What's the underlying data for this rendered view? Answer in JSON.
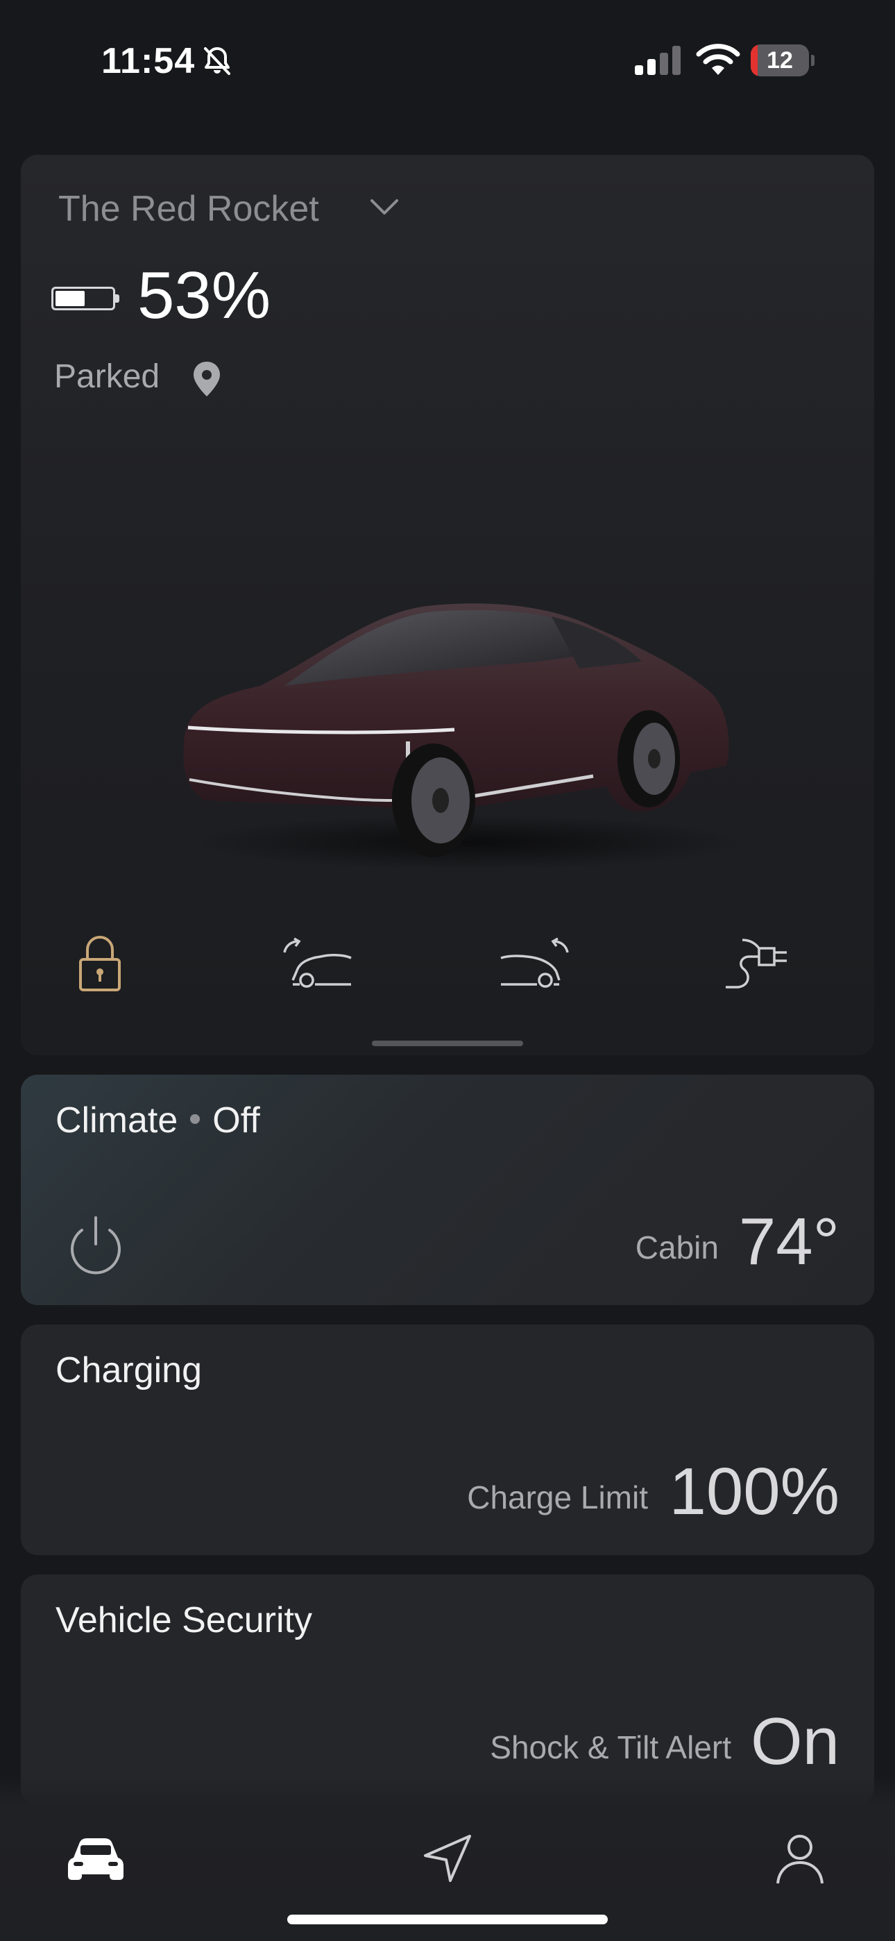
{
  "status_bar": {
    "time": "11:54",
    "battery_level": "12",
    "battery_fraction": 0.12,
    "icons": [
      "bell-slash-icon",
      "cellular-signal-icon",
      "wifi-icon",
      "battery-icon"
    ]
  },
  "vehicle": {
    "name": "The Red Rocket",
    "battery_percent": "53%",
    "battery_fraction": 0.53,
    "state": "Parked",
    "icons": [
      "battery-icon",
      "location-pin-icon",
      "chevron-down-icon"
    ]
  },
  "quick_actions": [
    {
      "name": "lock-icon",
      "color": "#c9a777"
    },
    {
      "name": "frunk-open-icon",
      "color": "#cfcfd1"
    },
    {
      "name": "trunk-open-icon",
      "color": "#cfcfd1"
    },
    {
      "name": "charge-port-icon",
      "color": "#cfcfd1"
    }
  ],
  "climate": {
    "title": "Climate",
    "status": "Off",
    "label": "Cabin",
    "value": "74°"
  },
  "charging": {
    "title": "Charging",
    "label": "Charge Limit",
    "value": "100%"
  },
  "security": {
    "title": "Vehicle Security",
    "label": "Shock & Tilt Alert",
    "value": "On"
  },
  "tab_bar": {
    "items": [
      "car-icon",
      "navigation-arrow-icon",
      "profile-icon"
    ]
  }
}
